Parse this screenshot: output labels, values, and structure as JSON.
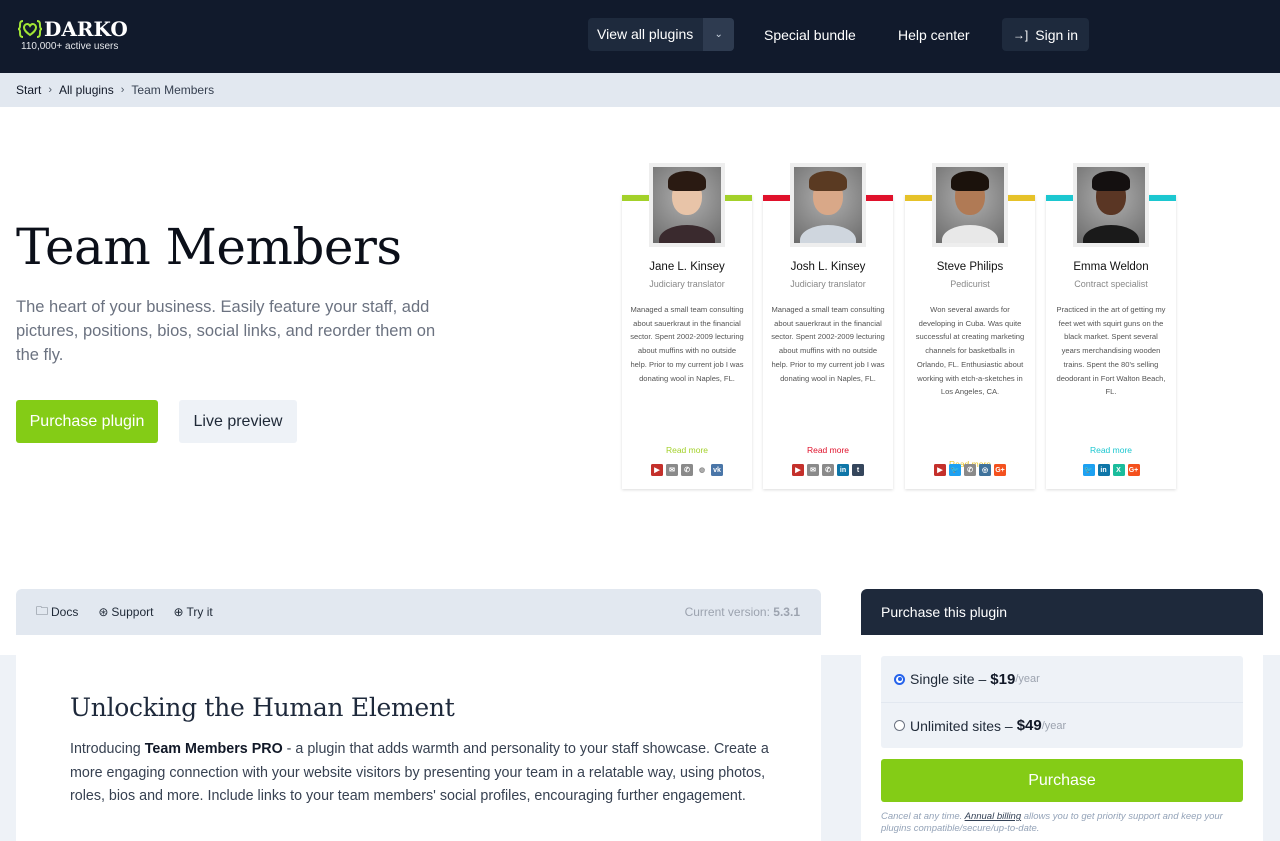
{
  "header": {
    "brand": "DARKO",
    "tagline": "110,000+ active users",
    "nav": {
      "view_all_plugins": "View all plugins",
      "special_bundle": "Special bundle",
      "help_center": "Help center",
      "sign_in": "Sign in"
    },
    "brand_accent": "#a3e635"
  },
  "breadcrumb": {
    "items": [
      "Start",
      "All plugins",
      "Team Members"
    ],
    "separator": "›"
  },
  "hero": {
    "title": "Team Members",
    "description": "The heart of your business. Easily feature your staff, add pictures, positions, bios, social links, and reorder them on the fly.",
    "purchase_button": "Purchase plugin",
    "preview_button": "Live preview"
  },
  "team_preview": {
    "members": [
      {
        "name": "Jane L. Kinsey",
        "role": "Judiciary translator",
        "bio": "Managed a small team consulting about sauerkraut in the financial sector. Spent 2002-2009 lecturing about muffins with no outside help. Prior to my current job I was donating wool in Naples, FL.",
        "read_more": "Read more",
        "accent": "#a3d12a",
        "socials": [
          "youtube",
          "email",
          "phone",
          "website",
          "vk"
        ]
      },
      {
        "name": "Josh L. Kinsey",
        "role": "Judiciary translator",
        "bio": "Managed a small team consulting about sauerkraut in the financial sector. Spent 2002-2009 lecturing about muffins with no outside help. Prior to my current job I was donating wool in Naples, FL.",
        "read_more": "Read more",
        "accent": "#e0112b",
        "socials": [
          "youtube",
          "email",
          "phone",
          "linkedin",
          "tumblr"
        ]
      },
      {
        "name": "Steve Philips",
        "role": "Pedicurist",
        "bio": "Won several awards for developing in Cuba. Was quite successful at creating marketing channels for basketballs in Orlando, FL. Enthusiastic about working with etch-a-sketches in Los Angeles, CA.",
        "read_more": "Read more",
        "accent": "#e6c229",
        "socials": [
          "youtube",
          "twitter",
          "phone",
          "instagram",
          "google-plus"
        ]
      },
      {
        "name": "Emma Weldon",
        "role": "Contract specialist",
        "bio": "Practiced in the art of getting my feet wet with squirt guns on the black market. Spent several years merchandising wooden trains. Spent the 80's selling deodorant in Fort Walton Beach, FL.",
        "read_more": "Read more",
        "accent": "#1cc7d0",
        "socials": [
          "twitter",
          "linkedin",
          "xing",
          "google-plus"
        ]
      }
    ]
  },
  "info_tabs": {
    "docs": "Docs",
    "support": "Support",
    "try_it": "Try it",
    "version_label": "Current version:",
    "version": "5.3.1"
  },
  "content": {
    "heading": "Unlocking the Human Element",
    "intro_before": "Introducing ",
    "intro_bold": "Team Members PRO",
    "intro_after": " - a plugin that adds warmth and personality to your staff showcase. Create a more engaging connection with your website visitors by presenting your team in a relatable way, using photos, roles, bios and more. Include links to your team members' social profiles, encouraging further engagement."
  },
  "purchase": {
    "title": "Purchase this plugin",
    "options": [
      {
        "label": "Single site –",
        "price": "$19",
        "period": "/year",
        "selected": true
      },
      {
        "label": "Unlimited sites –",
        "price": "$49",
        "period": "/year",
        "selected": false
      }
    ],
    "button": "Purchase",
    "note_before": "Cancel at any time. ",
    "note_link": "Annual billing",
    "note_after": " allows you to get priority support and keep your plugins compatible/secure/up-to-date."
  }
}
